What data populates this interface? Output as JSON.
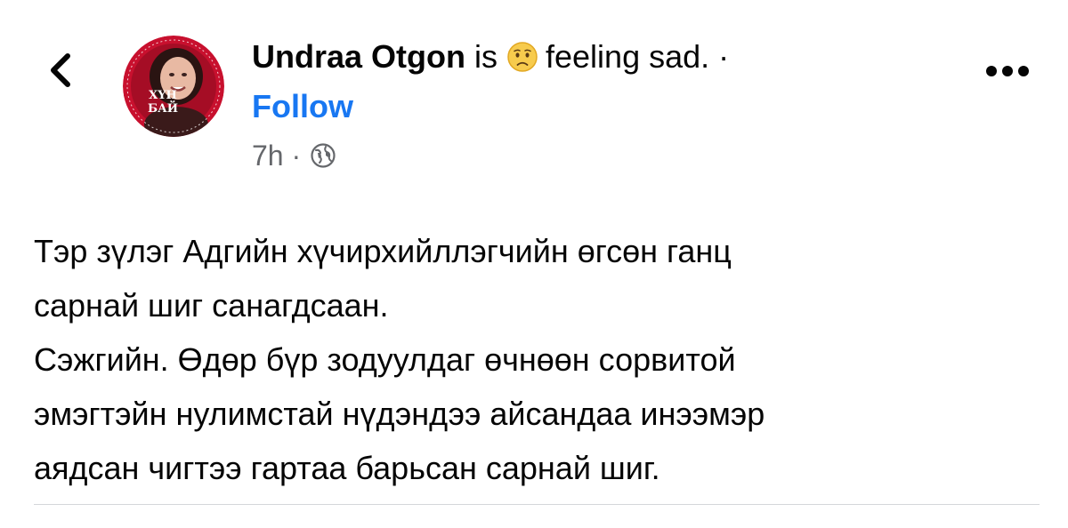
{
  "post": {
    "author": {
      "name": "Undraa Otgon",
      "avatar_caption": "ХҮН БАЙ"
    },
    "status": {
      "verb": "is",
      "emoji_icon": "sad-face-icon",
      "feeling_text": "feeling sad.",
      "separator": "·"
    },
    "follow_label": "Follow",
    "meta": {
      "time": "7h",
      "separator": "·",
      "privacy_icon": "globe-icon"
    },
    "more_icon": "more-dots-icon",
    "back_icon": "chevron-left-icon",
    "paragraphs": [
      "Тэр зүлэг Адгийн хүчирхийллэгчийн өгсөн ганц\nсарнай шиг санагдсаан.",
      "Сэжгийн. Өдөр бүр зодуулдаг өчнөөн сорвитой\nэмэгтэйн нулимстай нүдэндээ айсандаа инээмэр\nаядсан чигтээ гартаа барьсан сарнай шиг."
    ]
  },
  "colors": {
    "link_blue": "#1877f2",
    "secondary_text": "#65676b",
    "primary_text": "#050505",
    "avatar_red": "#c8102e"
  }
}
